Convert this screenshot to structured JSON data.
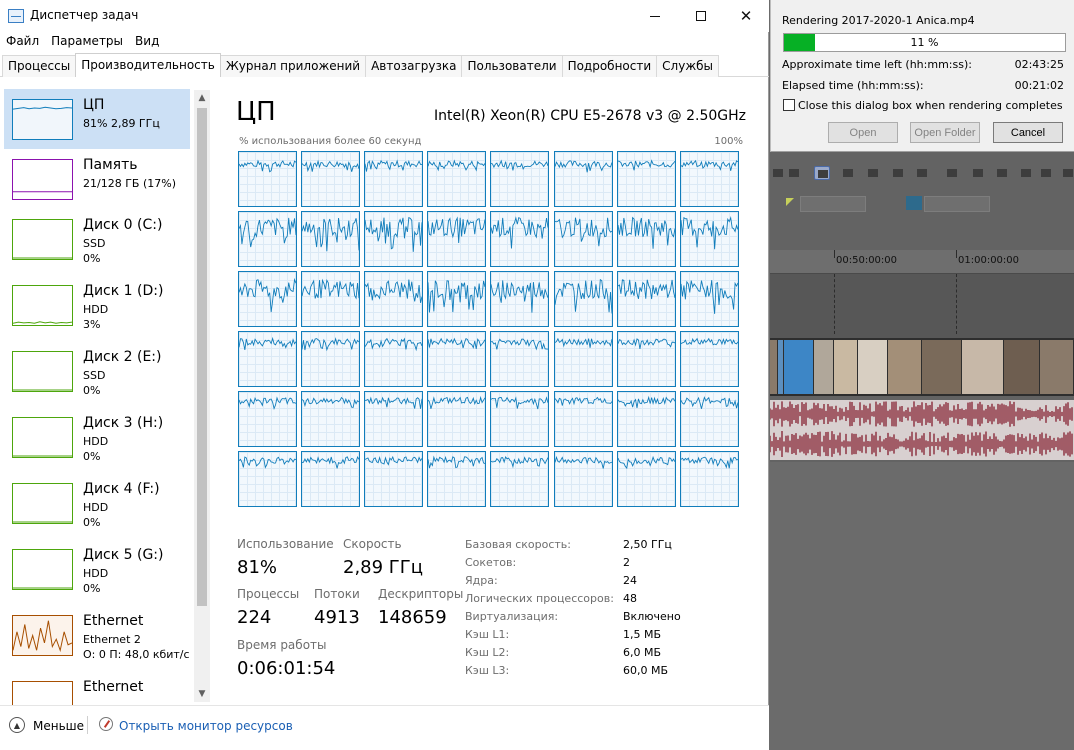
{
  "window": {
    "title": "Диспетчер задач"
  },
  "menu": [
    "Файл",
    "Параметры",
    "Вид"
  ],
  "tabs": [
    {
      "label": "Процессы",
      "active": false
    },
    {
      "label": "Производительность",
      "active": true
    },
    {
      "label": "Журнал приложений",
      "active": false
    },
    {
      "label": "Автозагрузка",
      "active": false
    },
    {
      "label": "Пользователи",
      "active": false
    },
    {
      "label": "Подробности",
      "active": false
    },
    {
      "label": "Службы",
      "active": false
    }
  ],
  "sidebar": {
    "items": [
      {
        "name": "ЦП",
        "sub": "81% 2,89 ГГц",
        "val": "",
        "color": "#117dbb",
        "fill": "#f1f6fb",
        "graph": [
          0.78,
          0.8,
          0.82,
          0.79,
          0.81,
          0.8,
          0.83,
          0.81,
          0.79,
          0.8,
          0.82,
          0.81
        ]
      },
      {
        "name": "Память",
        "sub": "21/128 ГБ (17%)",
        "val": "",
        "color": "#8b12ae",
        "fill": "#ffffff",
        "graph": [
          0.17,
          0.17,
          0.17,
          0.17,
          0.17,
          0.17,
          0.17,
          0.17,
          0.17,
          0.17,
          0.17,
          0.17
        ]
      },
      {
        "name": "Диск 0 (C:)",
        "sub": "SSD",
        "val": "0%",
        "color": "#4da60c",
        "fill": "#ffffff",
        "graph": [
          0,
          0,
          0,
          0,
          0,
          0,
          0,
          0,
          0,
          0,
          0,
          0
        ]
      },
      {
        "name": "Диск 1 (D:)",
        "sub": "HDD",
        "val": "3%",
        "color": "#4da60c",
        "fill": "#ffffff",
        "graph": [
          0.02,
          0.05,
          0.03,
          0.04,
          0.02,
          0.06,
          0.03,
          0.05,
          0.02,
          0.04,
          0.03,
          0.05
        ]
      },
      {
        "name": "Диск 2 (E:)",
        "sub": "SSD",
        "val": "0%",
        "color": "#4da60c",
        "fill": "#ffffff",
        "graph": [
          0,
          0,
          0,
          0,
          0,
          0,
          0,
          0,
          0,
          0,
          0,
          0
        ]
      },
      {
        "name": "Диск 3 (H:)",
        "sub": "HDD",
        "val": "0%",
        "color": "#4da60c",
        "fill": "#ffffff",
        "graph": [
          0,
          0,
          0,
          0,
          0,
          0,
          0,
          0,
          0,
          0,
          0,
          0
        ]
      },
      {
        "name": "Диск 4 (F:)",
        "sub": "HDD",
        "val": "0%",
        "color": "#4da60c",
        "fill": "#ffffff",
        "graph": [
          0,
          0,
          0,
          0,
          0,
          0,
          0,
          0,
          0,
          0,
          0,
          0
        ]
      },
      {
        "name": "Диск 5 (G:)",
        "sub": "HDD",
        "val": "0%",
        "color": "#4da60c",
        "fill": "#ffffff",
        "graph": [
          0,
          0,
          0,
          0,
          0,
          0,
          0,
          0,
          0,
          0,
          0,
          0
        ]
      },
      {
        "name": "Ethernet",
        "sub": "Ethernet 2",
        "val": "О: 0 П: 48,0 кбит/с",
        "color": "#a74f01",
        "fill": "#fcf3eb",
        "graph": [
          0.1,
          0.6,
          0.2,
          0.8,
          0.15,
          0.5,
          0.1,
          0.7,
          0.3,
          0.9,
          0.2,
          0.4,
          0.1,
          0.6,
          0.25,
          0.3
        ]
      },
      {
        "name": "Ethernet",
        "sub": "",
        "val": "",
        "color": "#a74f01",
        "fill": "#ffffff",
        "graph": [
          0.1,
          0.2,
          0.1
        ]
      }
    ]
  },
  "cpu": {
    "title": "ЦП",
    "model": "Intel(R) Xeon(R) CPU E5-2678 v3 @ 2.50GHz",
    "graph_caption": "% использования более 60 секунд",
    "graph_max": "100%",
    "core_rows": 6,
    "core_cols": 8,
    "row_levels": [
      0.78,
      0.72,
      0.68,
      0.82,
      0.84,
      0.85
    ],
    "line_color": "#117dbb"
  },
  "stats": {
    "usage_label": "Использование",
    "usage_value": "81%",
    "speed_label": "Скорость",
    "speed_value": "2,89 ГГц",
    "processes_label": "Процессы",
    "processes_value": "224",
    "threads_label": "Потоки",
    "threads_value": "4913",
    "handles_label": "Дескрипторы",
    "handles_value": "148659",
    "uptime_label": "Время работы",
    "uptime_value": "0:06:01:54"
  },
  "specs": [
    {
      "label": "Базовая скорость:",
      "value": "2,50 ГГц"
    },
    {
      "label": "Сокетов:",
      "value": "2"
    },
    {
      "label": "Ядра:",
      "value": "24"
    },
    {
      "label": "Логических процессоров:",
      "value": "48"
    },
    {
      "label": "Виртуализация:",
      "value": "Включено"
    },
    {
      "label": "Кэш L1:",
      "value": "1,5 МБ"
    },
    {
      "label": "Кэш L2:",
      "value": "6,0 МБ"
    },
    {
      "label": "Кэш L3:",
      "value": "60,0 МБ"
    }
  ],
  "footer": {
    "less_label": "Меньше",
    "resource_monitor_label": "Открыть монитор ресурсов"
  },
  "render_dialog": {
    "title": "Rendering 2017-2020-1 Anica.mp4",
    "progress_percent": 11,
    "progress_text": "11 %",
    "time_left_label": "Approximate time left (hh:mm:ss):",
    "time_left_value": "02:43:25",
    "elapsed_label": "Elapsed time (hh:mm:ss):",
    "elapsed_value": "00:21:02",
    "close_checkbox_label": "Close this dialog box when rendering completes",
    "close_checked": false,
    "open_button": "Open",
    "open_folder_button": "Open Folder",
    "cancel_button": "Cancel"
  },
  "editor": {
    "ruler_labels": [
      "00:50:00:00",
      "01:00:00:00"
    ]
  }
}
